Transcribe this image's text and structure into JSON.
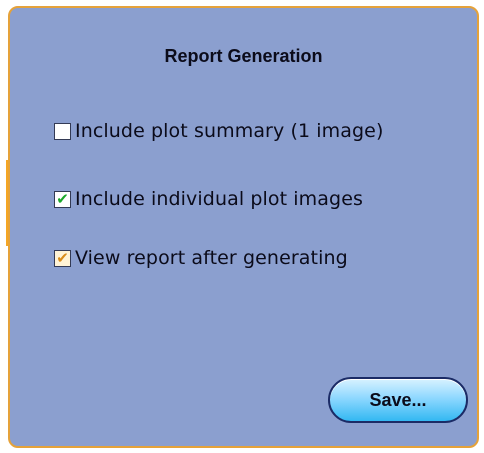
{
  "panel": {
    "title": "Report Generation",
    "options": [
      {
        "label": "Include plot summary (1 image)",
        "checked": false
      },
      {
        "label": "Include individual plot images",
        "checked": true
      },
      {
        "label": "View report after generating",
        "checked": true
      }
    ],
    "save_label": "Save..."
  },
  "colors": {
    "panel_background": "#8b9fcf",
    "panel_border": "#e5a23a",
    "check_green": "#1aa82a",
    "check_gold": "#d98c1a",
    "button_gradient_bottom": "#33b8f2"
  },
  "icons": {
    "checked": "check-icon"
  }
}
